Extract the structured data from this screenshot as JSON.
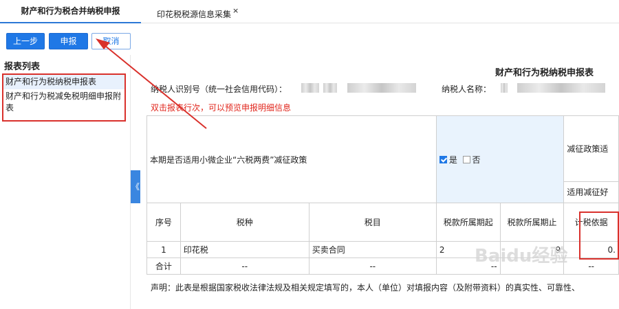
{
  "tabs": [
    {
      "label": "财产和行为税合并纳税申报"
    },
    {
      "label": "印花税税源信息采集",
      "close": "×"
    }
  ],
  "toolbar": {
    "prev": "上一步",
    "submit": "申报",
    "cancel": "取消"
  },
  "sidebar": {
    "title": "报表列表",
    "items": [
      {
        "label": "财产和行为税纳税申报表"
      },
      {
        "label": "财产和行为税减免税明细申报附表"
      }
    ],
    "collapse": "《"
  },
  "form": {
    "title": "财产和行为税纳税申报表",
    "taxpayer_id_label": "纳税人识别号（统一社会信用代码）：",
    "taxpayer_name_label": "纳税人名称：",
    "hint": "双击报表行次，可以预览申报明细信息",
    "policy": {
      "question": "本期是否适用小微企业“六税两费”减征政策",
      "yes": "是",
      "no": "否",
      "reduction_basis": "减征政策适",
      "applicable_reduction": "适用减征好"
    },
    "columns": [
      "序号",
      "税种",
      "税目",
      "税款所属期起",
      "税款所属期止",
      "计税依据"
    ],
    "rows": [
      {
        "no": "1",
        "tax_type": "印花税",
        "tax_item": "买卖合同",
        "start": "2",
        "end": "9",
        "basis": "0."
      }
    ],
    "total": {
      "label": "合计",
      "tax_type": "--",
      "tax_item": "--",
      "start": "--",
      "end": "",
      "basis": "--"
    },
    "declaration": "声明：此表是根据国家税收法律法规及相关规定填写的，本人（单位）对填报内容（及附带资料）的真实性、可靠性、"
  },
  "watermark": "Baidu经验",
  "colors": {
    "accent": "#1f78e6",
    "highlight": "#d9302b",
    "hint": "#e1261c"
  }
}
